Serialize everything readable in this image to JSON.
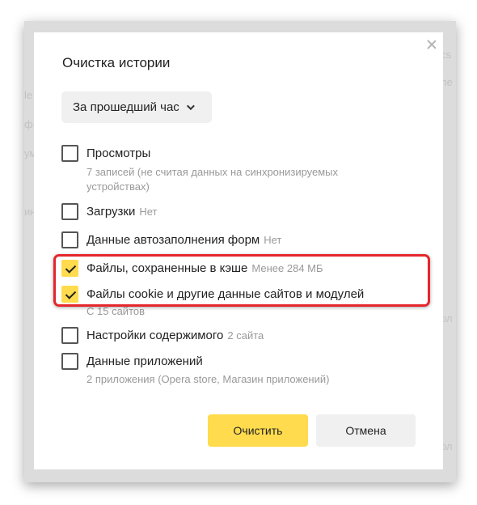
{
  "background_hints": [
    "cs",
    "le",
    "ф",
    "ум",
    "ин",
    "ле",
    "ол",
    "ол"
  ],
  "dialog": {
    "title": "Очистка истории",
    "period": "За прошедший час",
    "items": [
      {
        "label": "Просмотры",
        "hint": "",
        "checked": false,
        "sub": "7 записей (не считая данных на синхронизируемых устройствах)"
      },
      {
        "label": "Загрузки",
        "hint": "Нет",
        "checked": false,
        "sub": ""
      },
      {
        "label": "Данные автозаполнения форм",
        "hint": "Нет",
        "checked": false,
        "sub": ""
      },
      {
        "label": "Файлы, сохраненные в кэше",
        "hint": "Менее 284 МБ",
        "checked": true,
        "sub": ""
      },
      {
        "label": "Файлы cookie и другие данные сайтов и модулей",
        "hint": "",
        "checked": true,
        "sub": "С 15 сайтов"
      },
      {
        "label": "Настройки содержимого",
        "hint": "2 сайта",
        "checked": false,
        "sub": ""
      },
      {
        "label": "Данные приложений",
        "hint": "",
        "checked": false,
        "sub": "2 приложения (Opera store, Магазин приложений)"
      }
    ],
    "clear_button": "Очистить",
    "cancel_button": "Отмена"
  },
  "colors": {
    "accent": "#ffdb4d",
    "highlight": "#e5262b"
  }
}
